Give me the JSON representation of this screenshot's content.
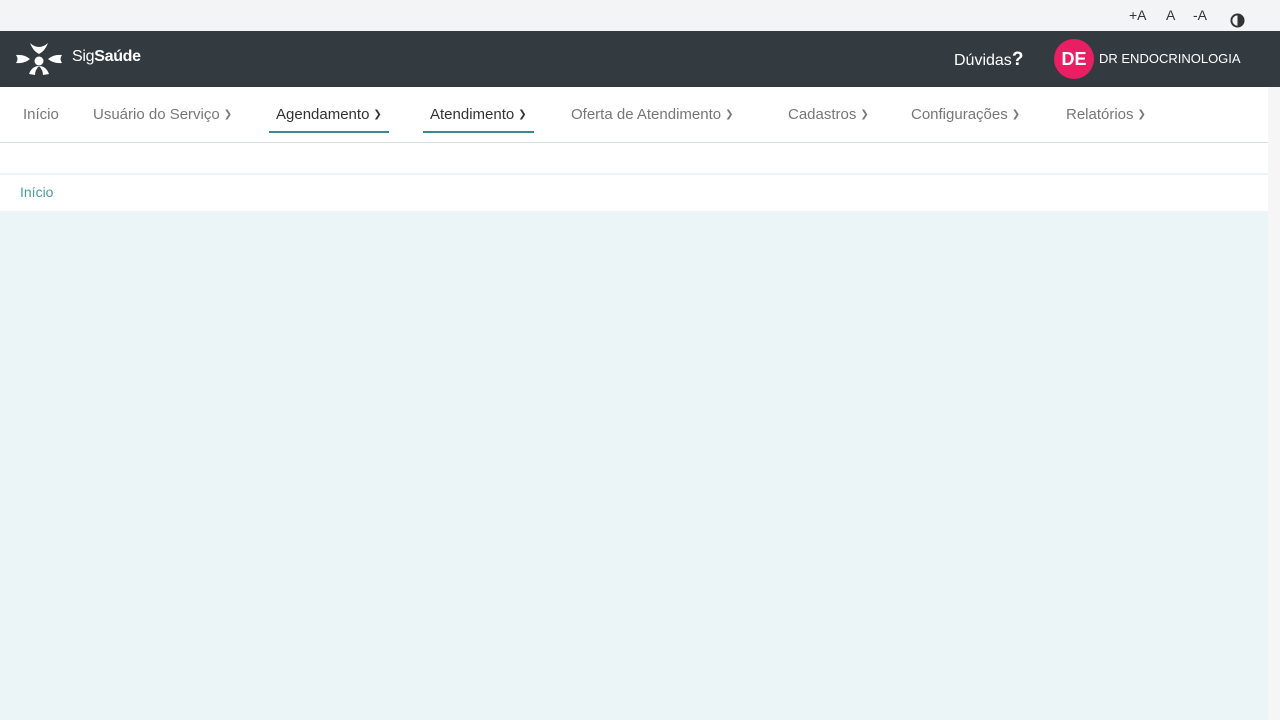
{
  "accessibility": {
    "increase_font": "+A",
    "default_font": "A",
    "decrease_font": "-A",
    "contrast_icon": "contrast-icon"
  },
  "header": {
    "logo_icon": "sigsaude-logo-icon",
    "brand_part1": "Sig",
    "brand_part2": "Saúde",
    "help_label": "Dúvidas",
    "help_mark": "?",
    "avatar_initials": "DE",
    "avatar_color": "#e91e63",
    "user_name": "DR ENDOCRINOLOGIA"
  },
  "nav": {
    "items": [
      {
        "label": "Início",
        "has_dropdown": false
      },
      {
        "label": "Usuário do Serviço",
        "has_dropdown": true
      },
      {
        "label": "Agendamento",
        "has_dropdown": true,
        "active": true
      },
      {
        "label": "Atendimento",
        "has_dropdown": true,
        "active": true
      },
      {
        "label": "Oferta de Atendimento",
        "has_dropdown": true
      },
      {
        "label": "Cadastros",
        "has_dropdown": true
      },
      {
        "label": "Configurações",
        "has_dropdown": true
      },
      {
        "label": "Relatórios",
        "has_dropdown": true
      }
    ],
    "dropdown_icon": "chevron-down-icon",
    "accent_color": "#3a8a8e"
  },
  "breadcrumb": {
    "items": [
      "Início"
    ]
  },
  "colors": {
    "header_bg": "#333b41",
    "page_bg": "#ebf4f7",
    "link": "#4a9ea3"
  }
}
